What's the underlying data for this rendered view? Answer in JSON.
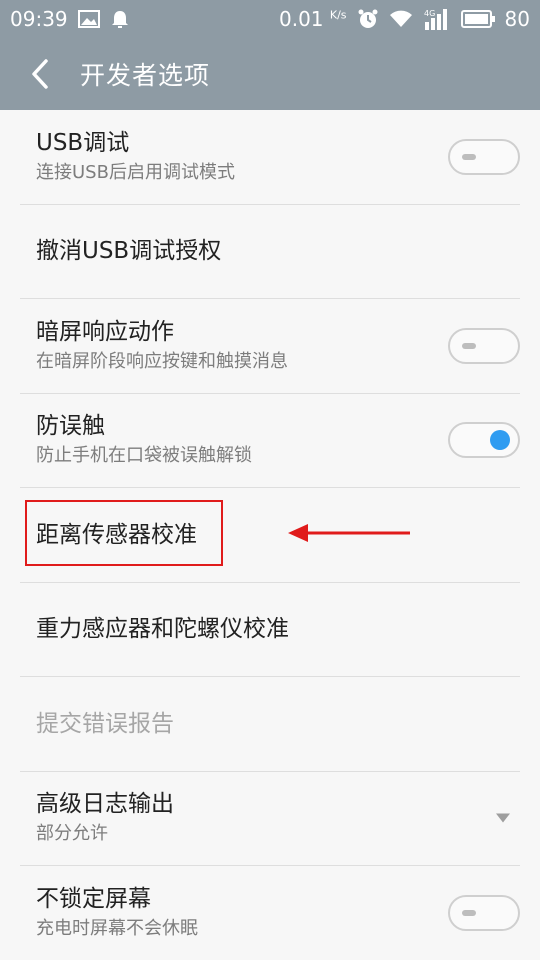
{
  "status_bar": {
    "time": "09:39",
    "net_speed": "0.01",
    "net_unit": "K/s",
    "signal_label": "4G",
    "battery": "80"
  },
  "header": {
    "title": "开发者选项"
  },
  "settings": {
    "usb_debug": {
      "title": "USB调试",
      "subtitle": "连接USB后启用调试模式",
      "enabled": false
    },
    "revoke_usb": {
      "title": "撤消USB调试授权"
    },
    "dark_screen": {
      "title": "暗屏响应动作",
      "subtitle": "在暗屏阶段响应按键和触摸消息",
      "enabled": false
    },
    "anti_touch": {
      "title": "防误触",
      "subtitle": "防止手机在口袋被误触解锁",
      "enabled": true
    },
    "proximity": {
      "title": "距离传感器校准"
    },
    "gravity": {
      "title": "重力感应器和陀螺仪校准"
    },
    "bug_report": {
      "title": "提交错误报告"
    },
    "log_output": {
      "title": "高级日志输出",
      "subtitle": "部分允许"
    },
    "stay_awake": {
      "title": "不锁定屏幕",
      "subtitle": "充电时屏幕不会休眠",
      "enabled": false
    }
  },
  "annotation": {
    "color": "#e01b1b"
  },
  "colors": {
    "accent": "#2f9cf1",
    "header_bg": "#8e9ba4"
  }
}
